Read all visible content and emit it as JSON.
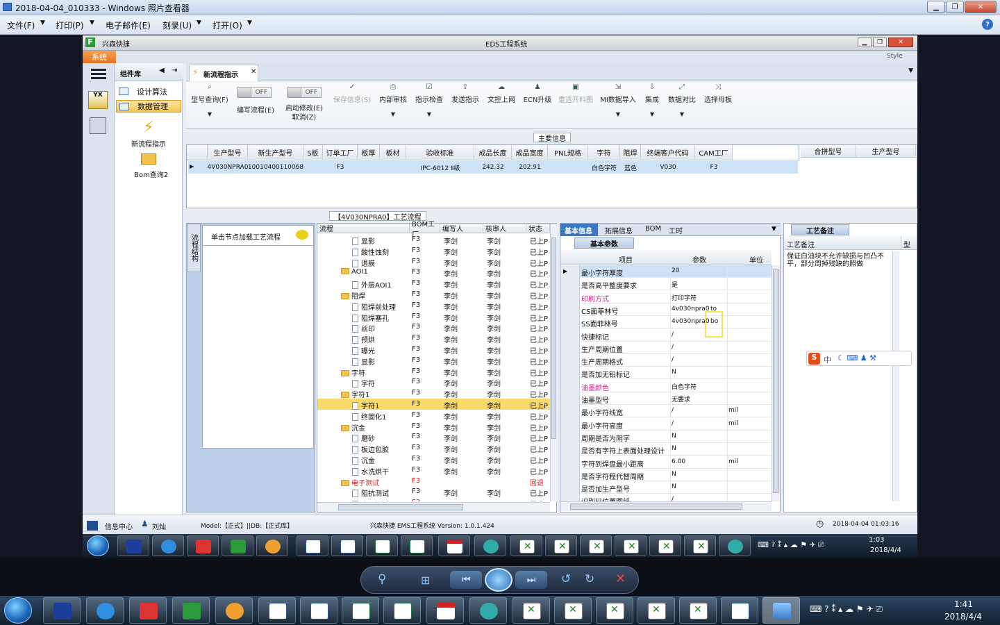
{
  "viewer": {
    "title": "2018-04-04_010333 - Windows 照片查看器",
    "menu": [
      "文件(F)",
      "打印(P)",
      "电子邮件(E)",
      "刻录(U)",
      "打开(O)"
    ],
    "help": "?"
  },
  "app": {
    "title": "EDS工程系统",
    "company": "兴森快捷",
    "style_label": "Style",
    "sys_tab": "系统",
    "library_title": "组件库",
    "library_items": [
      "设计算法",
      "数据管理"
    ],
    "tools": [
      {
        "label": "新流程指示"
      },
      {
        "label": "Bom查询2"
      }
    ],
    "doc_tab": "新流程指示",
    "ribbon": [
      {
        "label": "型号查询(F)",
        "enabled": true
      },
      {
        "label": "编写流程(E)",
        "toggle": "OFF"
      },
      {
        "label": "启动修改(E)\n取消(Z)",
        "toggle": "OFF"
      },
      {
        "label": "保存信息(S)",
        "enabled": false
      },
      {
        "label": "内部审核",
        "enabled": true
      },
      {
        "label": "指示检查",
        "enabled": true
      },
      {
        "label": "发送指示",
        "enabled": true
      },
      {
        "label": "文控上网",
        "enabled": true
      },
      {
        "label": "ECN升级",
        "enabled": true
      },
      {
        "label": "重选开料图",
        "enabled": false
      },
      {
        "label": "MI数据导入",
        "enabled": true
      },
      {
        "label": "集成",
        "enabled": true
      },
      {
        "label": "数据对比",
        "enabled": true
      },
      {
        "label": "选择母板",
        "enabled": true
      }
    ],
    "main_info": {
      "title": "主要信息",
      "columns": [
        "生产型号",
        "新生产型号",
        "S板",
        "订单工厂",
        "板厚",
        "板材",
        "验收标准",
        "成品长度",
        "成品宽度",
        "PNL规格",
        "字符",
        "阻焊",
        "终端客户代码",
        "CAM工厂"
      ],
      "row": [
        "4V030NPRA0",
        "10010400110068",
        "",
        "F3",
        "",
        "",
        "IPC-6012 Ⅱ级",
        "242.32",
        "202.91",
        "",
        "白色字符",
        "蓝色",
        "V030",
        "F3"
      ],
      "side_columns": [
        "合拼型号",
        "生产型号"
      ]
    },
    "left_panel": {
      "vtab": "流程结构",
      "hint": "单击节点加载工艺流程"
    },
    "process": {
      "title": "【4V030NPRA0】工艺流程",
      "columns": [
        "流程",
        "BOM工厂",
        "编写人",
        "核审人",
        "状态"
      ],
      "rows": [
        {
          "name": "显影",
          "lvl": 2,
          "factory": "F3",
          "writer": "李剑",
          "reviewer": "李剑",
          "status": "已上P"
        },
        {
          "name": "酸性蚀刻",
          "lvl": 2,
          "factory": "F3",
          "writer": "李剑",
          "reviewer": "李剑",
          "status": "已上P"
        },
        {
          "name": "退膜",
          "lvl": 2,
          "factory": "F3",
          "writer": "李剑",
          "reviewer": "李剑",
          "status": "已上P"
        },
        {
          "name": "AOI1",
          "lvl": 1,
          "factory": "F3",
          "writer": "李剑",
          "reviewer": "李剑",
          "status": "已上P"
        },
        {
          "name": "外层AOI1",
          "lvl": 2,
          "factory": "F3",
          "writer": "李剑",
          "reviewer": "李剑",
          "status": "已上P"
        },
        {
          "name": "阻焊",
          "lvl": 1,
          "factory": "F3",
          "writer": "李剑",
          "reviewer": "李剑",
          "status": "已上P"
        },
        {
          "name": "阻焊前处理",
          "lvl": 2,
          "factory": "F3",
          "writer": "李剑",
          "reviewer": "李剑",
          "status": "已上P"
        },
        {
          "name": "阻焊塞孔",
          "lvl": 2,
          "factory": "F3",
          "writer": "李剑",
          "reviewer": "李剑",
          "status": "已上P"
        },
        {
          "name": "丝印",
          "lvl": 2,
          "factory": "F3",
          "writer": "李剑",
          "reviewer": "李剑",
          "status": "已上P"
        },
        {
          "name": "预烘",
          "lvl": 2,
          "factory": "F3",
          "writer": "李剑",
          "reviewer": "李剑",
          "status": "已上P"
        },
        {
          "name": "曝光",
          "lvl": 2,
          "factory": "F3",
          "writer": "李剑",
          "reviewer": "李剑",
          "status": "已上P"
        },
        {
          "name": "显影",
          "lvl": 2,
          "factory": "F3",
          "writer": "李剑",
          "reviewer": "李剑",
          "status": "已上P"
        },
        {
          "name": "字符",
          "lvl": 1,
          "factory": "F3",
          "writer": "李剑",
          "reviewer": "李剑",
          "status": "已上P"
        },
        {
          "name": "字符",
          "lvl": 2,
          "factory": "F3",
          "writer": "李剑",
          "reviewer": "李剑",
          "status": "已上P"
        },
        {
          "name": "字符1",
          "lvl": 1,
          "factory": "F3",
          "writer": "李剑",
          "reviewer": "李剑",
          "status": "已上P"
        },
        {
          "name": "字符1",
          "lvl": 2,
          "factory": "F3",
          "writer": "李剑",
          "reviewer": "李剑",
          "status": "已上P",
          "selected": true
        },
        {
          "name": "终固化1",
          "lvl": 2,
          "factory": "F3",
          "writer": "李剑",
          "reviewer": "李剑",
          "status": "已上P"
        },
        {
          "name": "沉金",
          "lvl": 1,
          "factory": "F3",
          "writer": "李剑",
          "reviewer": "李剑",
          "status": "已上P"
        },
        {
          "name": "磨砂",
          "lvl": 2,
          "factory": "F3",
          "writer": "李剑",
          "reviewer": "李剑",
          "status": "已上P"
        },
        {
          "name": "板边包胶",
          "lvl": 2,
          "factory": "F3",
          "writer": "李剑",
          "reviewer": "李剑",
          "status": "已上P"
        },
        {
          "name": "沉金",
          "lvl": 2,
          "factory": "F3",
          "writer": "李剑",
          "reviewer": "李剑",
          "status": "已上P"
        },
        {
          "name": "水洗烘干",
          "lvl": 2,
          "factory": "F3",
          "writer": "李剑",
          "reviewer": "李剑",
          "status": "已上P"
        },
        {
          "name": "电子测试",
          "lvl": 1,
          "factory": "F3",
          "writer": "",
          "reviewer": "",
          "status": "回退",
          "red": true
        },
        {
          "name": "阻抗测试",
          "lvl": 2,
          "factory": "F3",
          "writer": "李剑",
          "reviewer": "李剑",
          "status": "已上P"
        },
        {
          "name": "电子测试",
          "lvl": 2,
          "factory": "F3",
          "writer": "",
          "reviewer": "",
          "status": "回退",
          "red": true
        }
      ]
    },
    "props": {
      "tabs": [
        "基本信息",
        "拓展信息",
        "BOM",
        "工时"
      ],
      "subtab": "基本参数",
      "columns": [
        "项目",
        "参数",
        "单位"
      ],
      "rows": [
        {
          "item": "最小字符厚度",
          "value": "20",
          "unit": ""
        },
        {
          "item": "是否高平整度要求",
          "value": "是",
          "unit": ""
        },
        {
          "item": "印刷方式",
          "value": "打印字符",
          "unit": "",
          "pink": true
        },
        {
          "item": "CS面菲林号",
          "value": "4v030npra0",
          "extra": "to",
          "unit": ""
        },
        {
          "item": "SS面菲林号",
          "value": "4v030npra0",
          "extra": "bo",
          "unit": ""
        },
        {
          "item": "快捷标记",
          "value": "/",
          "unit": ""
        },
        {
          "item": "生产周期位置",
          "value": "/",
          "unit": ""
        },
        {
          "item": "生产周期格式",
          "value": "/",
          "unit": ""
        },
        {
          "item": "是否加无铅标记",
          "value": "N",
          "unit": ""
        },
        {
          "item": "油墨颜色",
          "value": "白色字符",
          "unit": "",
          "pink": true
        },
        {
          "item": "油墨型号",
          "value": "无要求",
          "unit": ""
        },
        {
          "item": "最小字符线宽",
          "value": "/",
          "unit": "mil"
        },
        {
          "item": "最小字符高度",
          "value": "/",
          "unit": "mil"
        },
        {
          "item": "周期是否为阴字",
          "value": "N",
          "unit": ""
        },
        {
          "item": "是否有字符上表面处理设计",
          "value": "N",
          "unit": ""
        },
        {
          "item": "字符到焊盘最小距离",
          "value": "6.00",
          "unit": "mil"
        },
        {
          "item": "是否字符程代替周期",
          "value": "N",
          "unit": ""
        },
        {
          "item": "是否加生产型号",
          "value": "N",
          "unit": ""
        },
        {
          "item": "识别码位置图纸",
          "value": "/",
          "unit": ""
        }
      ]
    },
    "craft": {
      "title": "工艺备注",
      "col": "工艺备注",
      "col2": "型",
      "text": "保证白油块不允许缺损与凹凸不平，部分周掉残缺的照做"
    },
    "status": {
      "center": "信息中心",
      "user": "刘灿",
      "model": "Model:【正式】||DB:【正式库】",
      "system": "兴森快捷 EMS工程系统 Version: 1.0.1.424",
      "time": "2018-04-04 01:03:16"
    },
    "inner_clock": {
      "time": "1:03",
      "date": "2018/4/4"
    }
  },
  "outer_clock": {
    "time": "1:41",
    "date": "2018/4/4"
  },
  "ime": {
    "label": "中"
  }
}
